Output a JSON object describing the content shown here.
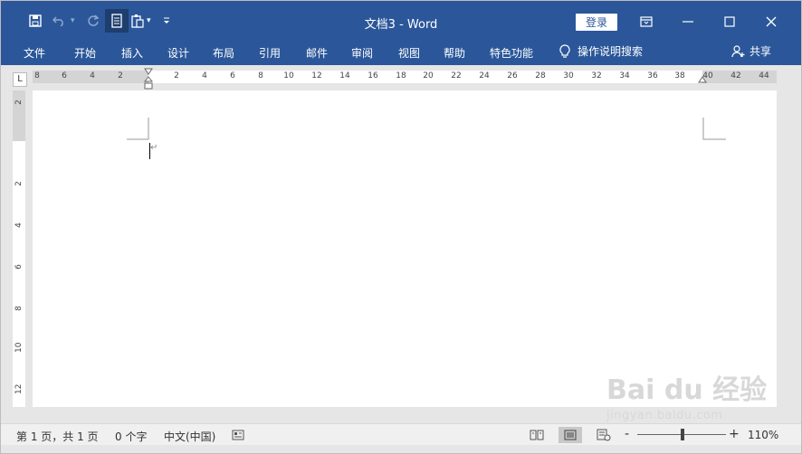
{
  "window": {
    "title": "文档3 - Word",
    "login_label": "登录"
  },
  "ribbon": {
    "tabs": [
      "文件",
      "开始",
      "插入",
      "设计",
      "布局",
      "引用",
      "邮件",
      "审阅",
      "视图",
      "帮助",
      "特色功能"
    ],
    "tell_me": "操作说明搜索",
    "share": "共享"
  },
  "ruler": {
    "tab_selector": "L",
    "hnums": [
      "8",
      "6",
      "4",
      "2",
      "2",
      "4",
      "6",
      "8",
      "10",
      "12",
      "14",
      "16",
      "18",
      "20",
      "22",
      "24",
      "26",
      "28",
      "30",
      "32",
      "34",
      "36",
      "38",
      "40",
      "42",
      "44"
    ],
    "vnums": [
      "2",
      "2",
      "4",
      "6",
      "8",
      "10",
      "12"
    ]
  },
  "document": {
    "paragraph_mark": "↵"
  },
  "status": {
    "page": "第 1 页，共 1 页",
    "words": "0 个字",
    "language": "中文(中国)",
    "zoom_minus": "-",
    "zoom_plus": "+",
    "zoom": "110%"
  },
  "watermark": {
    "brand": "Bai du 经验",
    "url": "jingyan.baidu.com"
  },
  "colors": {
    "accent": "#2b579a",
    "ribbon_dark": "#1d3e6e"
  }
}
